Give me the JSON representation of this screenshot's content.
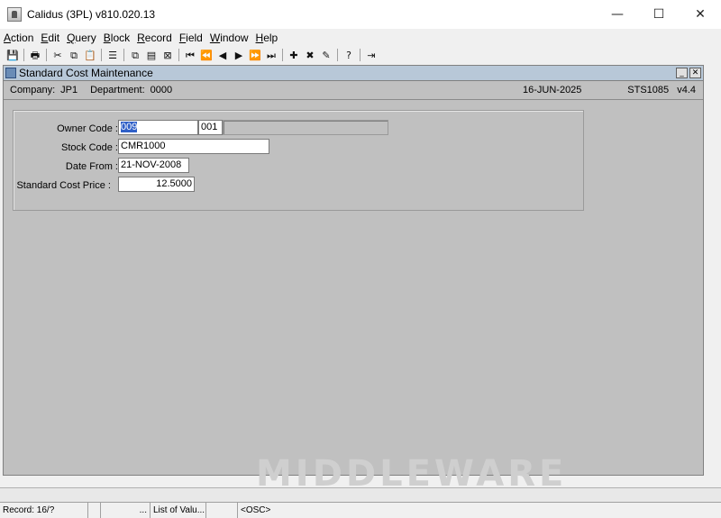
{
  "window": {
    "title": "Calidus (3PL) v810.020.13",
    "controls": {
      "minimize": "—",
      "maximize": "☐",
      "close": "✕"
    }
  },
  "menu": [
    {
      "label": "Action",
      "key": "A",
      "rest": "ction"
    },
    {
      "label": "Edit",
      "key": "E",
      "rest": "dit"
    },
    {
      "label": "Query",
      "key": "Q",
      "rest": "uery"
    },
    {
      "label": "Block",
      "key": "B",
      "rest": "lock"
    },
    {
      "label": "Record",
      "key": "R",
      "rest": "ecord"
    },
    {
      "label": "Field",
      "key": "F",
      "rest": "ield"
    },
    {
      "label": "Window",
      "key": "W",
      "rest": "indow"
    },
    {
      "label": "Help",
      "key": "H",
      "rest": "elp"
    }
  ],
  "toolbar": {
    "icons": [
      {
        "name": "save-icon",
        "glyph": "💾"
      },
      {
        "sep": true
      },
      {
        "name": "print-icon",
        "glyph": "🖶"
      },
      {
        "sep": true
      },
      {
        "name": "cut-icon",
        "glyph": "✂"
      },
      {
        "name": "copy-icon",
        "glyph": "⧉"
      },
      {
        "name": "paste-icon",
        "glyph": "📋"
      },
      {
        "sep": true
      },
      {
        "name": "list-icon",
        "glyph": "☰"
      },
      {
        "sep": true
      },
      {
        "name": "enter-query-icon",
        "glyph": "⧉"
      },
      {
        "name": "execute-query-icon",
        "glyph": "▤"
      },
      {
        "name": "cancel-query-icon",
        "glyph": "⊠"
      },
      {
        "sep": true
      },
      {
        "name": "first-record-icon",
        "glyph": "⏮"
      },
      {
        "name": "previous-set-icon",
        "glyph": "⏪"
      },
      {
        "name": "previous-record-icon",
        "glyph": "◀"
      },
      {
        "name": "next-record-icon",
        "glyph": "▶"
      },
      {
        "name": "next-set-icon",
        "glyph": "⏩"
      },
      {
        "name": "last-record-icon",
        "glyph": "⏭"
      },
      {
        "sep": true
      },
      {
        "name": "insert-record-icon",
        "glyph": "✚"
      },
      {
        "name": "delete-record-icon",
        "glyph": "✖"
      },
      {
        "name": "clear-record-icon",
        "glyph": "✎"
      },
      {
        "sep": true
      },
      {
        "name": "help-icon",
        "glyph": "?"
      },
      {
        "sep": true
      },
      {
        "name": "exit-icon",
        "glyph": "⇥"
      }
    ]
  },
  "form": {
    "title": "Standard Cost Maintenance",
    "controls": {
      "minimize": "_",
      "close": "✕"
    },
    "company_label": "Company:",
    "company_value": "JP1",
    "department_label": "Department:",
    "department_value": "0000",
    "date": "16-JUN-2025",
    "form_code": "STS1085",
    "version": "v4.4",
    "fields": {
      "owner_code_label": "Owner Code :",
      "owner_code_value": "009",
      "owner_code_value2": "001",
      "owner_desc_value": "",
      "stock_code_label": "Stock Code :",
      "stock_code_value": "CMR1000",
      "date_from_label": "Date From :",
      "date_from_value": "21-NOV-2008",
      "std_cost_label": "Standard Cost Price :",
      "std_cost_value": "12.5000"
    },
    "watermark": "MIDDLEWARE"
  },
  "status": {
    "record": "Record: 16/?",
    "cell2": "",
    "cell3": "...",
    "lov": "List of Valu...",
    "cell5": "",
    "osc": "<OSC>"
  }
}
